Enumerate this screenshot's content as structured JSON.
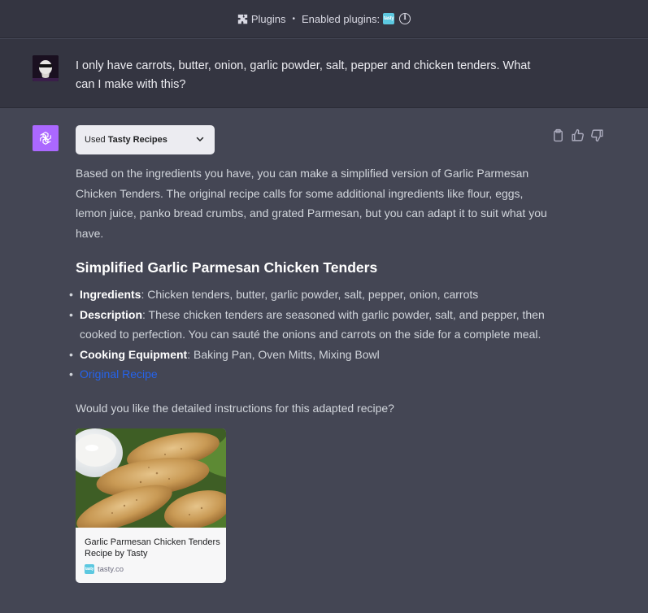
{
  "topbar": {
    "plugins_label": "Plugins",
    "separator": "•",
    "enabled_label": "Enabled plugins:",
    "tasty_logo_text": "tasty"
  },
  "user_message": {
    "text": "I only have carrots, butter, onion, garlic powder, salt, pepper and chicken tenders. What can I make with this?"
  },
  "plugin_pill": {
    "used_label": "Used",
    "plugin_name": "Tasty Recipes"
  },
  "response": {
    "intro": "Based on the ingredients you have, you can make a simplified version of Garlic Parmesan Chicken Tenders. The original recipe calls for some additional ingredients like flour, eggs, lemon juice, panko bread crumbs, and grated Parmesan, but you can adapt it to suit what you have.",
    "heading": "Simplified Garlic Parmesan Chicken Tenders",
    "items": [
      {
        "label": "Ingredients",
        "text": ": Chicken tenders, butter, garlic powder, salt, pepper, onion, carrots"
      },
      {
        "label": "Description",
        "text": ": These chicken tenders are seasoned with garlic powder, salt, and pepper, then cooked to perfection. You can sauté the onions and carrots on the side for a complete meal."
      },
      {
        "label": "Cooking Equipment",
        "text": ": Baking Pan, Oven Mitts, Mixing Bowl"
      }
    ],
    "link_text": "Original Recipe",
    "question": "Would you like the detailed instructions for this adapted recipe?"
  },
  "card": {
    "title": "Garlic Parmesan Chicken Tenders Recipe by Tasty",
    "source": "tasty.co"
  },
  "colors": {
    "page_bg": "#444654",
    "user_bg": "#343541",
    "gpt_avatar": "#ab68ff",
    "link": "#2563eb"
  }
}
